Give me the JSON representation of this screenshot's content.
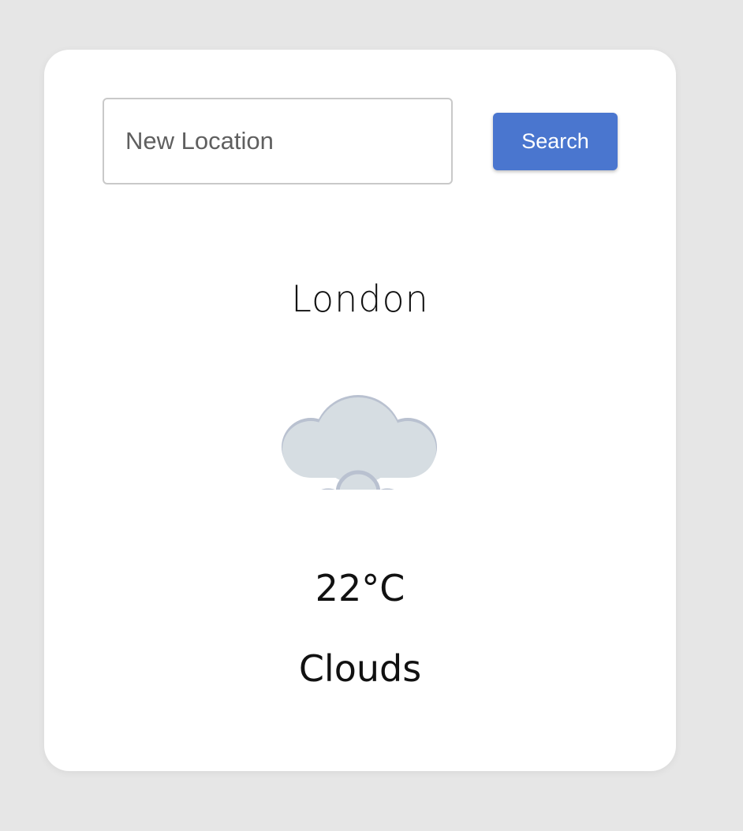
{
  "search": {
    "placeholder": "New Location",
    "value": "",
    "button_label": "Search"
  },
  "weather": {
    "city": "London",
    "temperature": "22°C",
    "condition": "Clouds",
    "icon": "cloud-icon"
  },
  "colors": {
    "page_background": "#e6e6e6",
    "card_background": "#ffffff",
    "accent": "#4a76cf",
    "cloud_fill": "#d6dde2",
    "cloud_edge": "#b9c1d0"
  }
}
